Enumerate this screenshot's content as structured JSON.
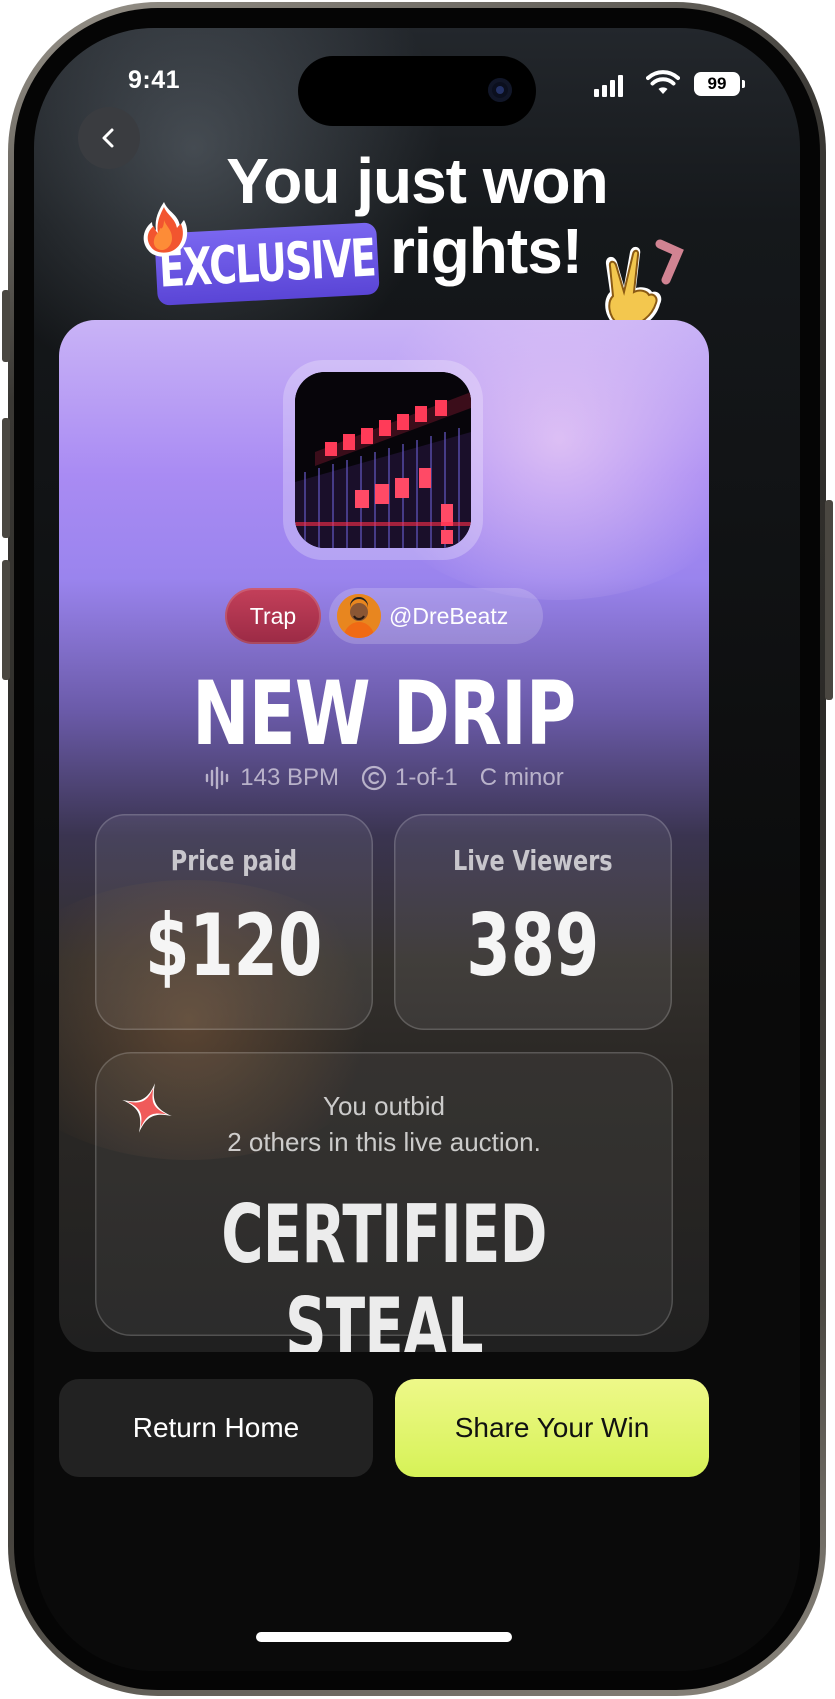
{
  "status_bar": {
    "time": "9:41",
    "battery": "99"
  },
  "header": {
    "line1": "You just won",
    "badge": "EXCLUSIVE",
    "line2": "rights!"
  },
  "track": {
    "genre": "Trap",
    "producer": "@DreBeatz",
    "title": "NEW DRIP",
    "bpm": "143 BPM",
    "license": "1-of-1",
    "key": "C minor"
  },
  "stats": {
    "price": {
      "label": "Price paid",
      "value": "$120"
    },
    "viewers": {
      "label": "Live Viewers",
      "value": "389"
    }
  },
  "result": {
    "line1": "You outbid",
    "line2": "2 others in this live auction.",
    "headline": "CERTIFIED STEAL"
  },
  "actions": {
    "home": "Return Home",
    "share": "Share Your Win"
  },
  "colors": {
    "badge": "#6a55e3",
    "genre_chip": "#b3354f",
    "share_button": "#e3f56a",
    "sparkle": "#f05a5a"
  }
}
